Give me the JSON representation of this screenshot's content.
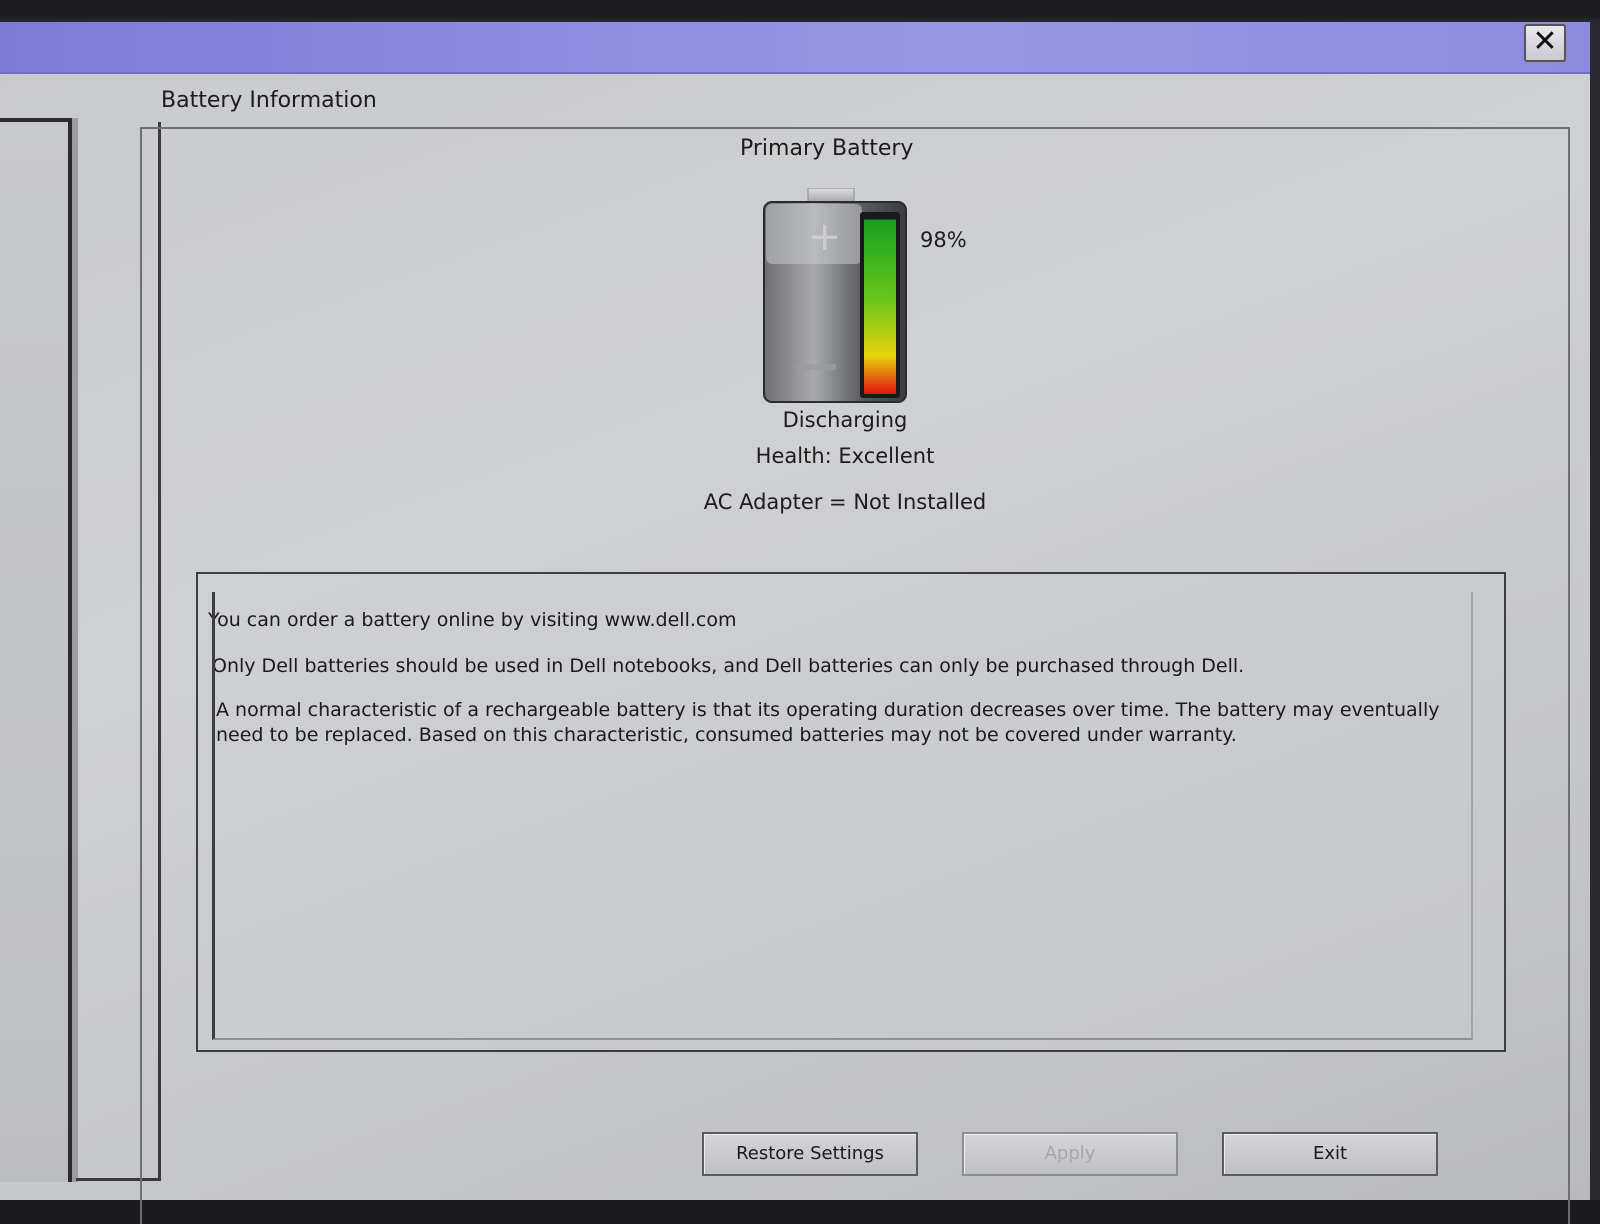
{
  "window": {
    "close_glyph": "✕"
  },
  "group": {
    "legend": "Battery Information"
  },
  "battery": {
    "name": "Primary Battery",
    "percent_label": "98%",
    "charge_fraction": 0.98,
    "status": "Discharging",
    "health": "Health: Excellent",
    "ac_adapter": "AC Adapter = Not Installed",
    "gauge_colors": [
      "#18a020",
      "#66c61a",
      "#e8d20c",
      "#e21410"
    ]
  },
  "info": {
    "line1": "You can order a battery online by visiting www.dell.com",
    "line2": "Only Dell batteries should be used in Dell notebooks, and Dell batteries can only be purchased through Dell.",
    "line3": "A normal characteristic of a rechargeable battery is that its operating duration decreases over time.  The battery may eventually need to be replaced.  Based on this characteristic, consumed batteries may not be covered under warranty."
  },
  "buttons": {
    "restore": "Restore Settings",
    "apply": "Apply",
    "exit": "Exit"
  }
}
